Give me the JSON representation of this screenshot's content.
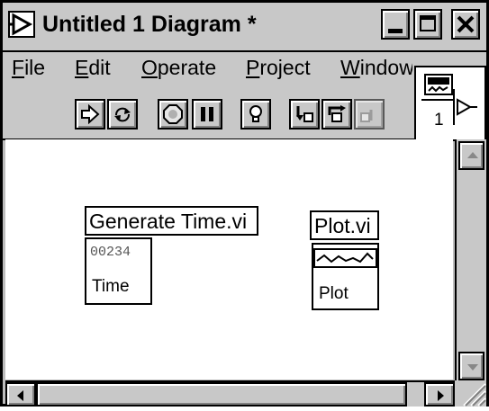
{
  "window": {
    "title": "Untitled 1 Diagram *",
    "minimize_icon": "minimize-icon",
    "maximize_icon": "maximize-icon",
    "close_icon": "close-icon"
  },
  "menubar": {
    "items": [
      {
        "label": "File",
        "mnemonic": "F",
        "rest": "ile"
      },
      {
        "label": "Edit",
        "mnemonic": "E",
        "rest": "dit"
      },
      {
        "label": "Operate",
        "mnemonic": "O",
        "rest": "perate"
      },
      {
        "label": "Project",
        "mnemonic": "P",
        "rest": "roject"
      },
      {
        "label": "Window",
        "mnemonic": "W",
        "rest": "indow"
      }
    ]
  },
  "toolbar": {
    "buttons": [
      "run-arrow-icon",
      "run-continuously-icon",
      "abort-icon",
      "pause-icon",
      "highlight-execution-icon",
      "step-into-icon",
      "step-over-icon",
      "step-out-icon"
    ]
  },
  "connector_pane": {
    "number": "1"
  },
  "diagram": {
    "nodes": [
      {
        "label": "Generate Time.vi",
        "icon_counter": "00234",
        "icon_text": "Time"
      },
      {
        "label": "Plot.vi",
        "icon_text": "Plot"
      }
    ]
  },
  "colors": {
    "chrome": "#c8c8c8",
    "canvas": "#ffffff",
    "border": "#000000"
  }
}
